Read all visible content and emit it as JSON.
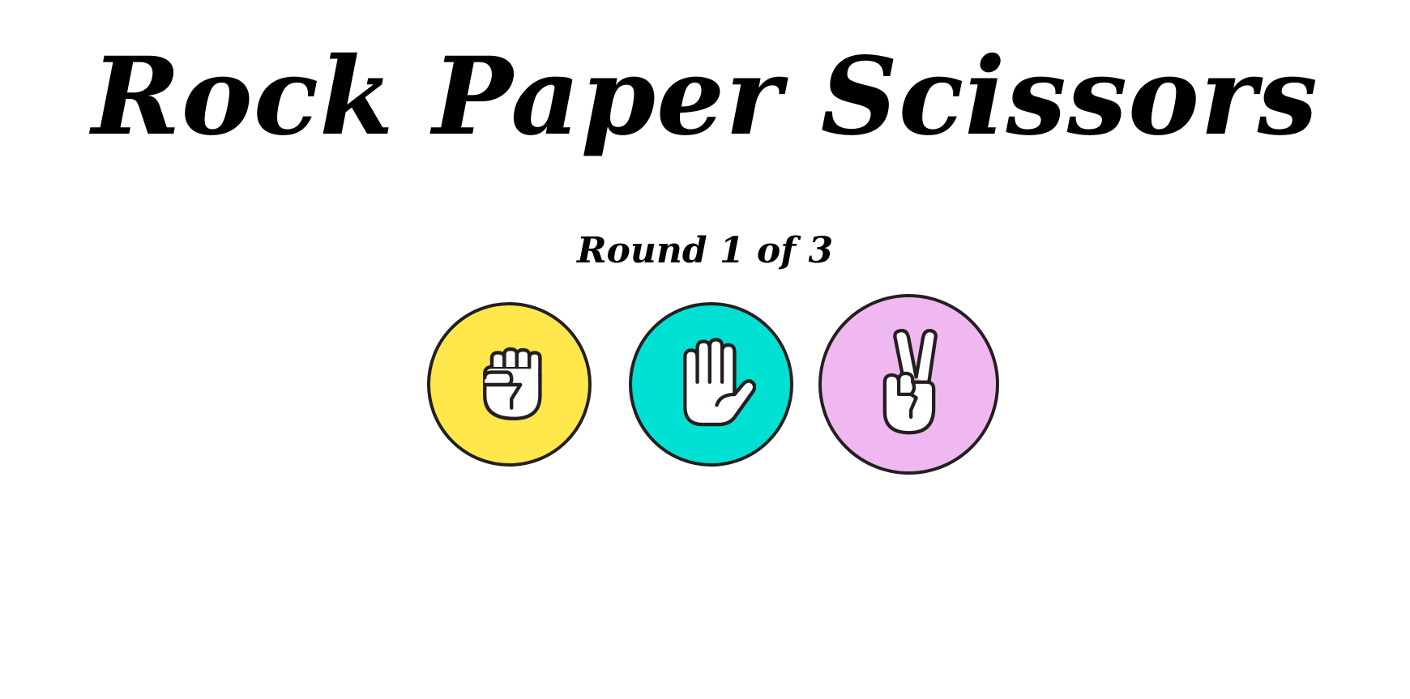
{
  "game": {
    "title": "Rock Paper Scissors",
    "round_text": "Round 1 of 3"
  },
  "choices": [
    {
      "id": "rock",
      "icon": "fist-icon",
      "color": "#ffe74c"
    },
    {
      "id": "paper",
      "icon": "open-hand-icon",
      "color": "#00e0d3"
    },
    {
      "id": "scissors",
      "icon": "peace-sign-icon",
      "color": "#f0b8f0"
    }
  ],
  "colors": {
    "outline": "#231f20",
    "text": "#000000",
    "background": "#ffffff"
  }
}
